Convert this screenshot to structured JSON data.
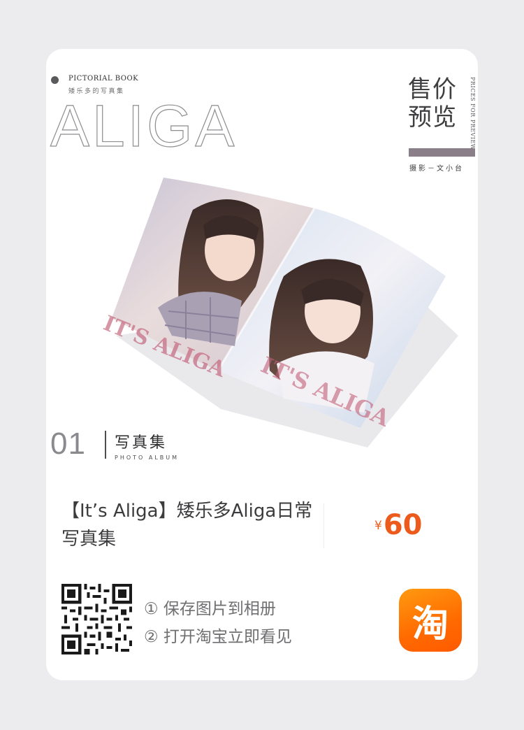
{
  "header": {
    "book_label": "PICTORIAL BOOK",
    "book_sub": "矮乐多的写真集",
    "big_title": "ALIGA",
    "price_title_line1": "售价",
    "price_title_line2": "预览",
    "vertical_text": "PRICES FOR PREVIEW",
    "photo_credit": "摄影－文小台"
  },
  "magazine": {
    "overlay_text": "IT'S ALIGA"
  },
  "album": {
    "number": "01",
    "label_cn": "写真集",
    "label_en": "PHOTO ALBUM"
  },
  "product": {
    "title": "【It’s Aliga】矮乐多Aliga日常写真集",
    "currency": "¥",
    "price": "60"
  },
  "instructions": {
    "step1": "① 保存图片到相册",
    "step2": "② 打开淘宝立即看见"
  },
  "app_icon": {
    "char": "淘",
    "name": "taobao-icon",
    "gradient_from": "#ff9a10",
    "gradient_to": "#ff5a00"
  },
  "colors": {
    "accent_price": "#ec5b1b",
    "price_bar": "#8a7f88"
  }
}
